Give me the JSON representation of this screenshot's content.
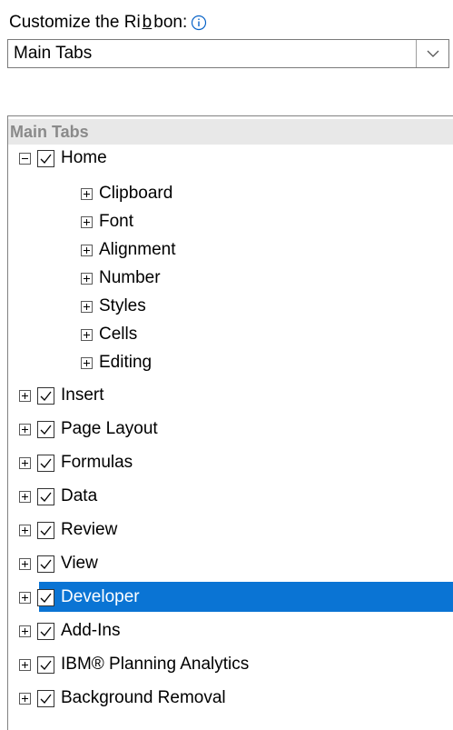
{
  "header": {
    "prefix": "Customize the Ri",
    "underlined": "b",
    "suffix": "bon:"
  },
  "combo": {
    "value": "Main Tabs"
  },
  "tree": {
    "group_label": "Main Tabs",
    "home": {
      "label": "Home",
      "checked": true,
      "expanded": true
    },
    "groups": [
      {
        "label": "Clipboard"
      },
      {
        "label": "Font"
      },
      {
        "label": "Alignment"
      },
      {
        "label": "Number"
      },
      {
        "label": "Styles"
      },
      {
        "label": "Cells"
      },
      {
        "label": "Editing"
      }
    ],
    "tabs": [
      {
        "label": "Insert",
        "checked": true
      },
      {
        "label": "Page Layout",
        "checked": true
      },
      {
        "label": "Formulas",
        "checked": true
      },
      {
        "label": "Data",
        "checked": true
      },
      {
        "label": "Review",
        "checked": true
      },
      {
        "label": "View",
        "checked": true
      },
      {
        "label": "Developer",
        "checked": true,
        "selected": true
      },
      {
        "label": "Add-Ins",
        "checked": true
      },
      {
        "label": "IBM® Planning Analytics",
        "checked": true
      },
      {
        "label": "Background Removal",
        "checked": true
      }
    ]
  },
  "colors": {
    "selection": "#0078d7",
    "info_icon": "#0a64c8"
  }
}
